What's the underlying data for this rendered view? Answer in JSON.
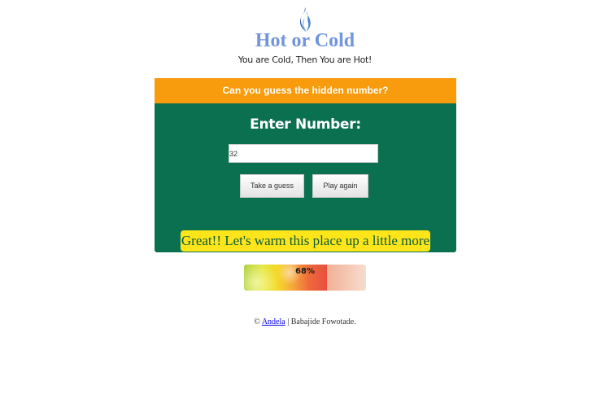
{
  "header": {
    "logo_icon": "flame-icon",
    "logo_color": "#2f62b3",
    "title": "Hot or Cold",
    "tagline": "You are Cold, Then You are Hot!"
  },
  "panel": {
    "prompt": "Can you guess the hidden number?",
    "enter_label": "Enter Number:",
    "input_value": "32",
    "input_placeholder": "",
    "guess_button_label": "Take a guess",
    "play_again_button_label": "Play again",
    "feedback": "Great!! Let's warm this place up a little more",
    "header_color": "#f89b0c",
    "body_color": "#0b7050"
  },
  "progress": {
    "label": "68%",
    "value": 0.68
  },
  "footer": {
    "copyright": "©",
    "link_text": "Andela",
    "separator": "|",
    "author": "Babajide Fowotade."
  }
}
